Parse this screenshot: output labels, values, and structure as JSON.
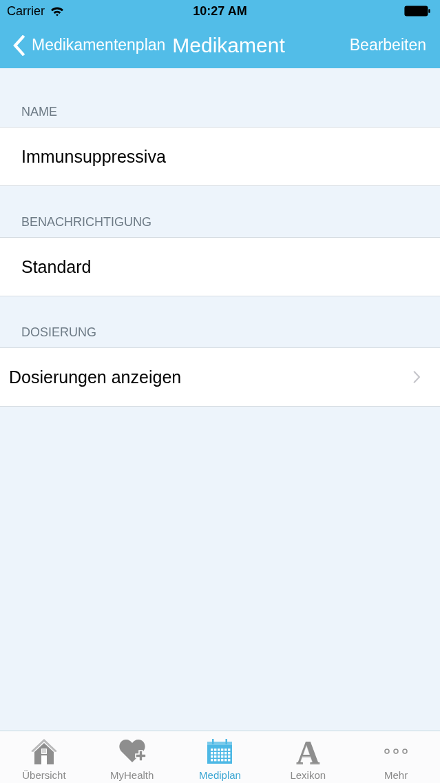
{
  "status_bar": {
    "carrier": "Carrier",
    "time": "10:27 AM"
  },
  "nav_bar": {
    "back_label": "Medikamentenplan",
    "title": "Medikament",
    "action": "Bearbeiten"
  },
  "sections": [
    {
      "header": "NAME",
      "rows": [
        {
          "kind": "value",
          "text": "Immunsuppressiva"
        }
      ]
    },
    {
      "header": "BENACHRICHTIGUNG",
      "rows": [
        {
          "kind": "value",
          "text": "Standard"
        }
      ]
    },
    {
      "header": "DOSIERUNG",
      "rows": [
        {
          "kind": "disclosure",
          "text": "Dosierungen anzeigen"
        }
      ]
    }
  ],
  "tab_bar": {
    "items": [
      {
        "label": "Übersicht",
        "selected": false
      },
      {
        "label": "MyHealth",
        "selected": false
      },
      {
        "label": "Mediplan",
        "selected": true
      },
      {
        "label": "Lexikon",
        "selected": false,
        "glyph": "A"
      },
      {
        "label": "Mehr",
        "selected": false
      }
    ]
  }
}
